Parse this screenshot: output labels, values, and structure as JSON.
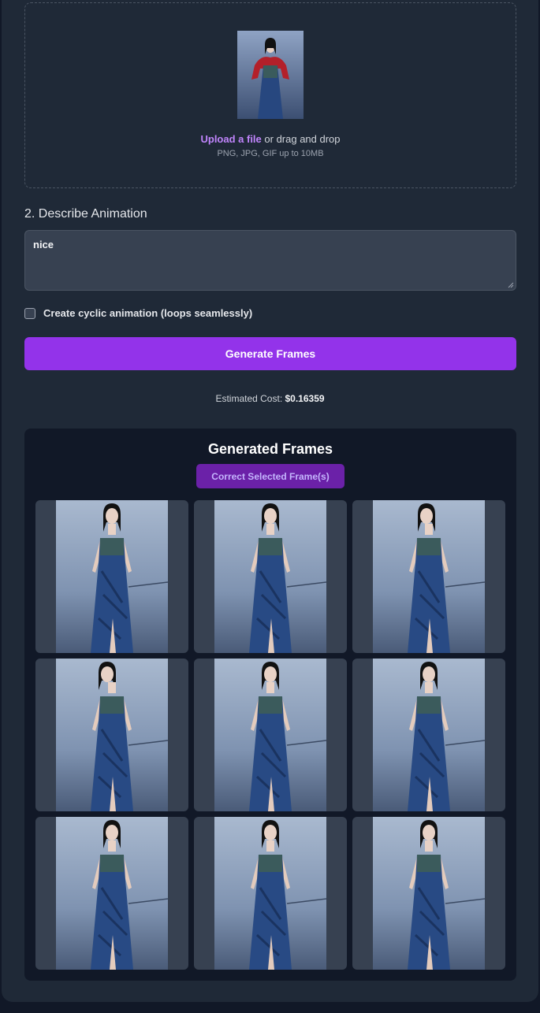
{
  "upload": {
    "link_text": "Upload a file",
    "drag_text": " or drag and drop",
    "hint": "PNG, JPG, GIF up to 10MB"
  },
  "describe": {
    "title": "2. Describe Animation",
    "prompt_value": "nice"
  },
  "cyclic": {
    "label": "Create cyclic animation (loops seamlessly)",
    "checked": false
  },
  "generate": {
    "label": "Generate Frames"
  },
  "cost": {
    "label": "Estimated Cost: ",
    "value": "$0.16359"
  },
  "frames": {
    "title": "Generated Frames",
    "correct_label": "Correct Selected Frame(s)",
    "count": 9
  },
  "colors": {
    "accent": "#9333ea",
    "link": "#c084fc",
    "card_bg": "#1f2937",
    "panel_bg": "#111827"
  }
}
